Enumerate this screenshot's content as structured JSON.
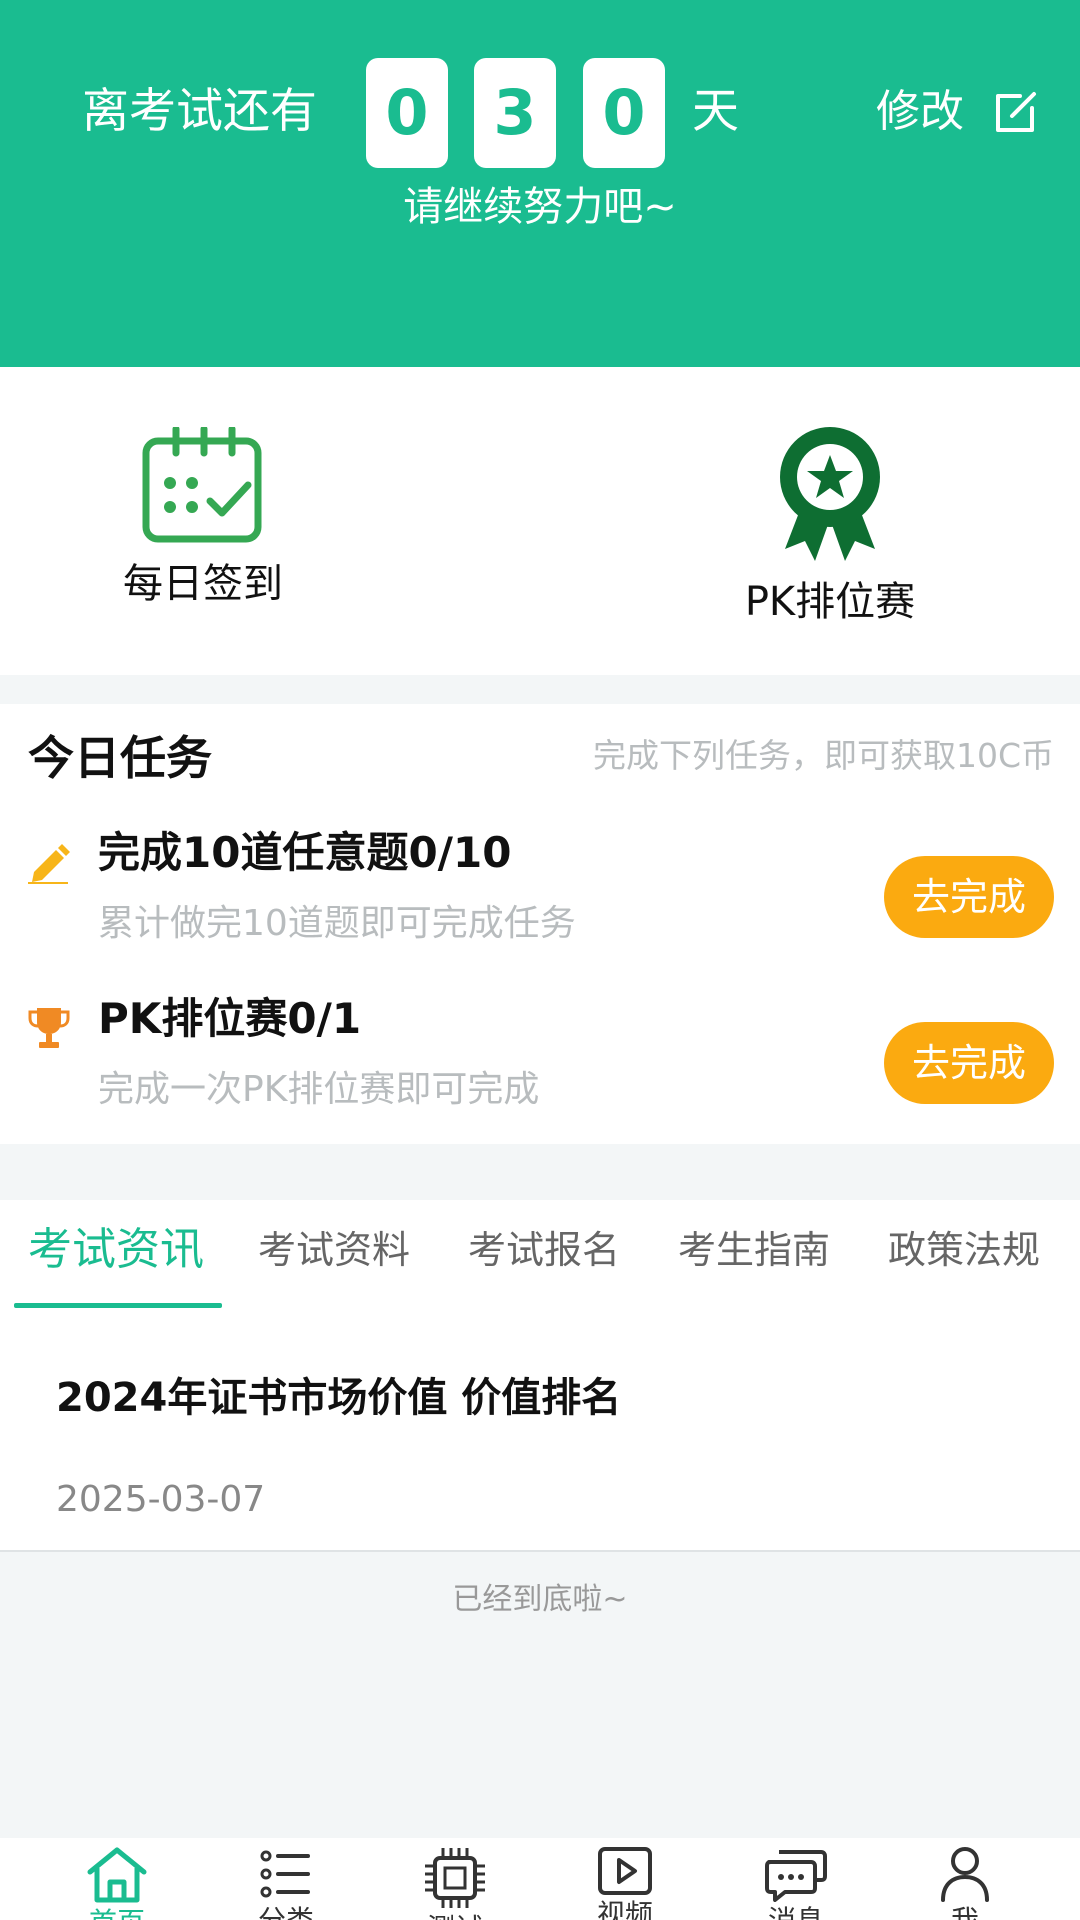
{
  "header": {
    "countdown_label": "离考试还有",
    "digits": [
      "0",
      "3",
      "0"
    ],
    "day_unit": "天",
    "edit_label": "修改",
    "encourage": "请继续努力吧~"
  },
  "quick_actions": [
    {
      "label": "每日签到",
      "icon": "calendar-check-icon"
    },
    {
      "label": "PK排位赛",
      "icon": "award-ribbon-icon"
    }
  ],
  "tasks": {
    "title": "今日任务",
    "hint": "完成下列任务，即可获取10C币",
    "items": [
      {
        "icon": "pencil-icon",
        "title": "完成10道任意题0/10",
        "desc": "累计做完10道题即可完成任务",
        "button": "去完成"
      },
      {
        "icon": "trophy-icon",
        "title": "PK排位赛0/1",
        "desc": "完成一次PK排位赛即可完成",
        "button": "去完成"
      }
    ]
  },
  "tabs": [
    "考试资讯",
    "考试资料",
    "考试报名",
    "考生指南",
    "政策法规"
  ],
  "news": {
    "title": "2024年证书市场价值 价值排名",
    "date": "2025-03-07"
  },
  "end_text": "已经到底啦~",
  "bottom_nav": [
    {
      "label": "首页",
      "icon": "home-icon",
      "active": true
    },
    {
      "label": "分类",
      "icon": "list-icon"
    },
    {
      "label": "测试",
      "icon": "chip-icon"
    },
    {
      "label": "视频",
      "icon": "play-icon"
    },
    {
      "label": "消息",
      "icon": "chat-icon"
    },
    {
      "label": "我",
      "icon": "user-icon"
    }
  ],
  "colors": {
    "primary": "#1abc90",
    "button": "#fbaa10",
    "award": "#0e6e32"
  }
}
